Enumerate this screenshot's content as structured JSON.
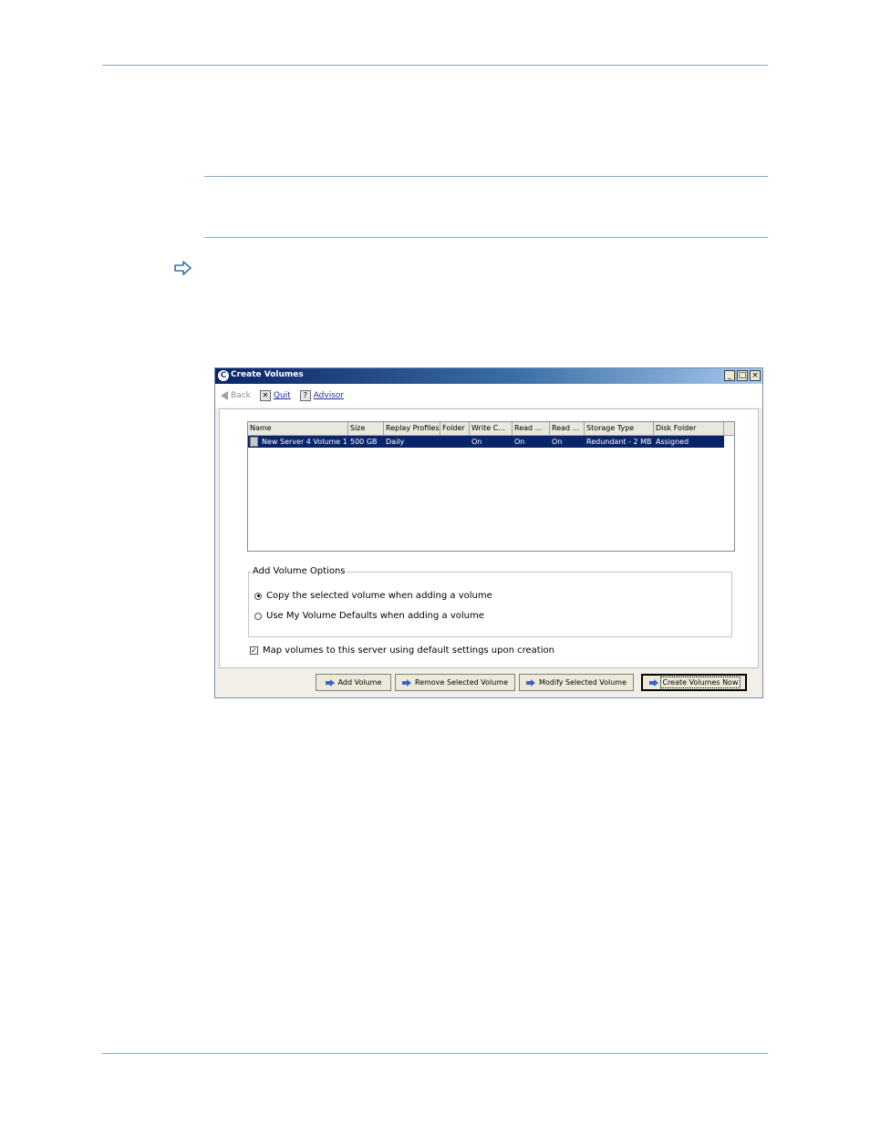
{
  "window": {
    "title": "Create Volumes",
    "app_icon_glyph": "C",
    "controls": {
      "minimize": "_",
      "maximize": "□",
      "close": "×"
    }
  },
  "toolbar": {
    "back_label": "Back",
    "quit_label": "Quit",
    "advisor_label": "Advisor"
  },
  "table": {
    "columns": [
      "Name",
      "Size",
      "Replay Profiles",
      "Folder",
      "Write C...",
      "Read ...",
      "Read ...",
      "Storage Type",
      "Disk Folder"
    ],
    "rows": [
      {
        "name": "New Server 4 Volume 1",
        "size": "500 GB",
        "replay_profiles": "Daily",
        "folder": "",
        "write_cache": "On",
        "read_cache": "On",
        "read_ahead": "On",
        "storage_type": "Redundant - 2 MB",
        "disk_folder": "Assigned",
        "selected": true
      }
    ]
  },
  "options": {
    "legend": "Add Volume Options",
    "copy_selected": "Copy the selected volume when adding a volume",
    "use_defaults": "Use My Volume Defaults when adding a volume",
    "selected_option": "copy_selected",
    "map_label": "Map volumes to this server using default settings upon creation",
    "map_checked": true
  },
  "buttons": {
    "add": "Add Volume",
    "remove": "Remove Selected Volume",
    "modify": "Modify Selected Volume",
    "create": "Create Volumes Now"
  },
  "colors": {
    "selection": "#0a246a",
    "rule": "#8aa6c4",
    "accent_arrow": "#3b66c7"
  }
}
